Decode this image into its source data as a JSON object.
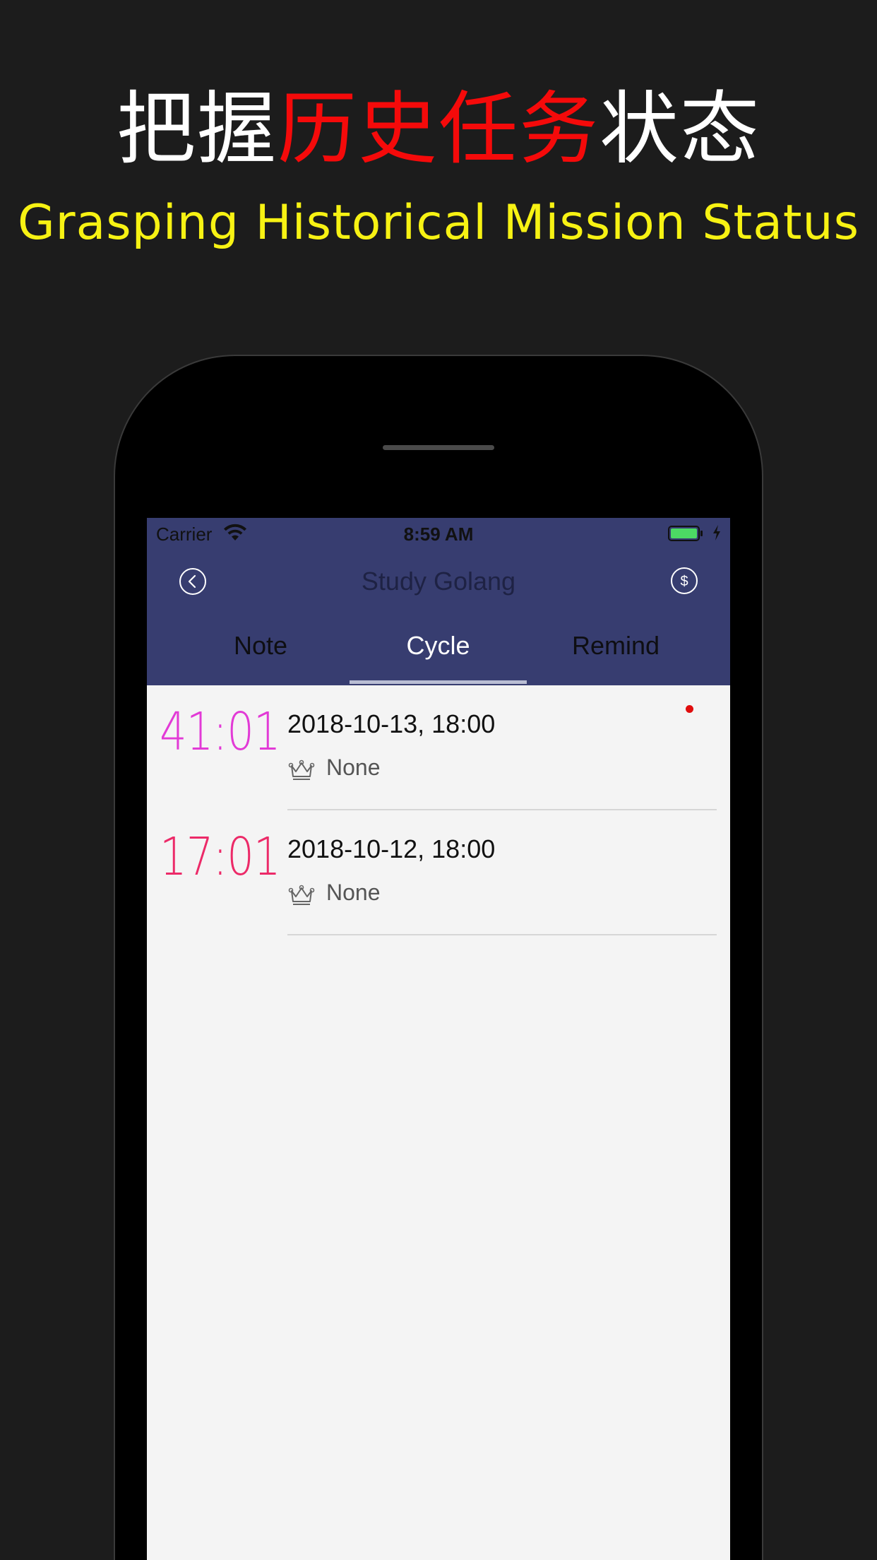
{
  "headline": {
    "cn_prefix": "把握",
    "cn_highlight": "历史任务",
    "cn_suffix": "状态",
    "en": "Grasping Historical Mission Status",
    "highlight_color": "#f50a0a",
    "en_color": "#f7f213"
  },
  "statusbar": {
    "carrier": "Carrier",
    "time": "8:59 AM",
    "battery_color": "#4cd964"
  },
  "navbar": {
    "title": "Study Golang",
    "back_icon": "chevron-left-circle-icon",
    "right_icon": "dollar-circle-icon",
    "bg_color": "#373d70"
  },
  "tabs": [
    {
      "label": "Note",
      "active": false
    },
    {
      "label": "Cycle",
      "active": true
    },
    {
      "label": "Remind",
      "active": false
    }
  ],
  "records": [
    {
      "duration": "41:01",
      "date": "2018-10-13, 18:00",
      "note": "None",
      "duration_color": "#e23ad6",
      "marked": false
    },
    {
      "duration": "17:01",
      "date": "2018-10-12, 18:00",
      "note": "None",
      "duration_color": "#ec2a68",
      "marked": true
    }
  ]
}
